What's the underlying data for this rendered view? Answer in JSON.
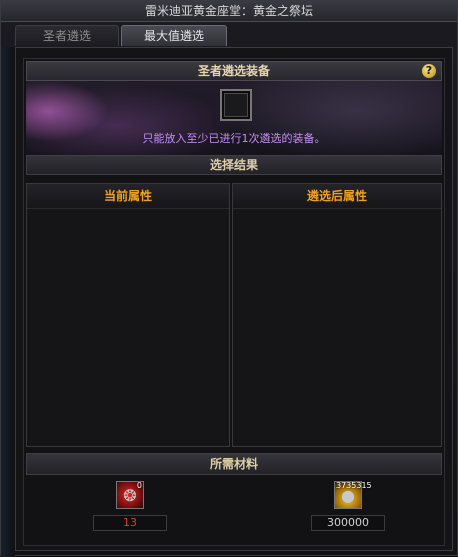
{
  "window": {
    "title": "雷米迪亚黄金座堂：黄金之祭坛"
  },
  "tabs": [
    {
      "label": "圣者遴选",
      "active": false
    },
    {
      "label": "最大值遴选",
      "active": true
    }
  ],
  "equipment_section": {
    "header": "圣者遴选装备",
    "help_icon": "?",
    "hint": "只能放入至少已进行1次遴选的装备。"
  },
  "result_section": {
    "header": "选择结果",
    "current_attributes_header": "当前属性",
    "after_attributes_header": "遴选后属性"
  },
  "materials_section": {
    "header": "所需材料",
    "items": [
      {
        "icon": "red-material-icon",
        "badge": "0",
        "count": "13",
        "count_color": "#e03b3b"
      },
      {
        "icon": "gold-coins-icon",
        "badge": "3735315",
        "count": "300000",
        "count_color": "#cfcfcf"
      }
    ]
  },
  "colors": {
    "attribute_header": "#f0a020",
    "hint_text": "#c58ef5",
    "section_header_text": "#e2d6b0"
  }
}
